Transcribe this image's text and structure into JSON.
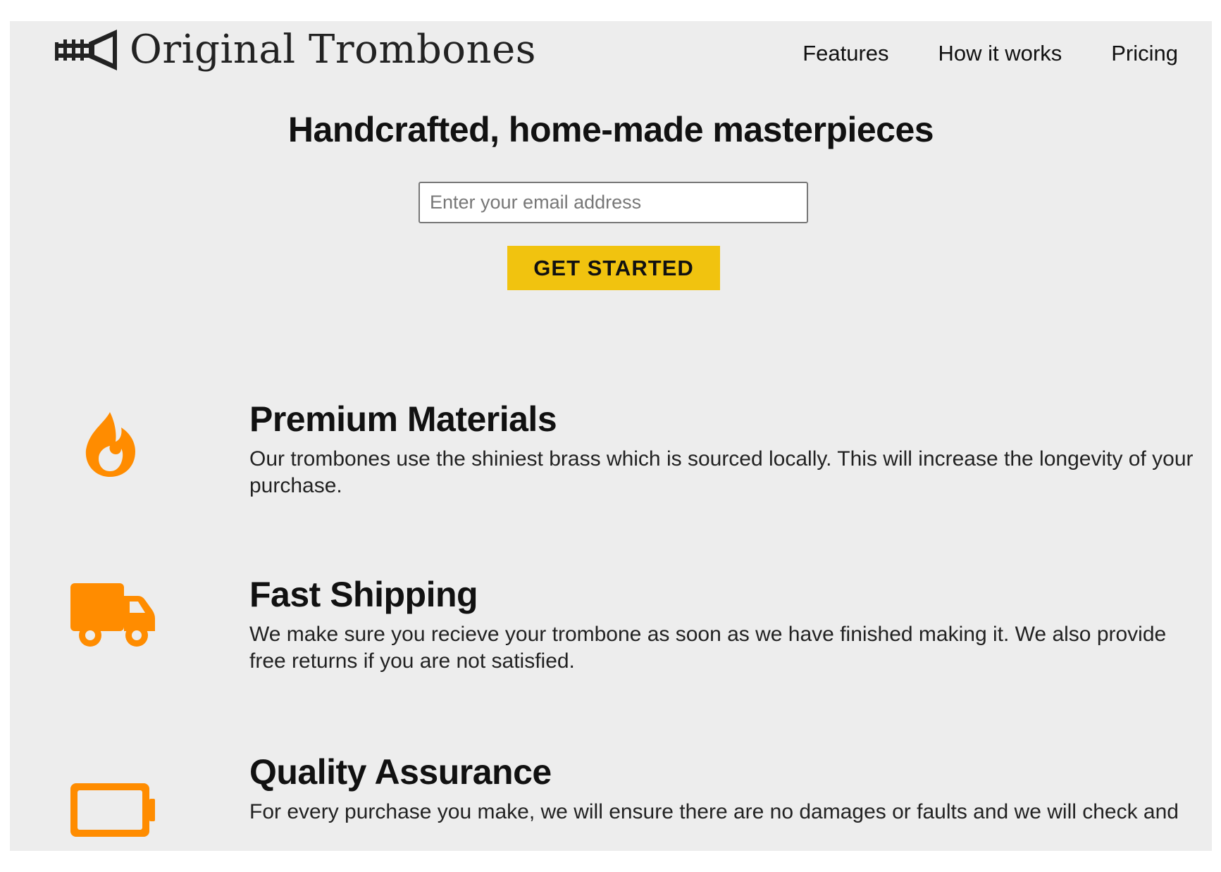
{
  "brand": {
    "name": "Original Trombones",
    "logo_icon": "trombone-icon"
  },
  "nav": {
    "items": [
      {
        "label": "Features"
      },
      {
        "label": "How it works"
      },
      {
        "label": "Pricing"
      }
    ]
  },
  "hero": {
    "headline": "Handcrafted, home-made masterpieces",
    "email_placeholder": "Enter your email address",
    "email_value": "",
    "cta_label": "GET STARTED",
    "cta_color": "#f1c30f"
  },
  "features": [
    {
      "icon": "fire-icon",
      "title": "Premium Materials",
      "description": "Our trombones use the shiniest brass which is sourced locally. This will increase the longevity of your purchase."
    },
    {
      "icon": "truck-icon",
      "title": "Fast Shipping",
      "description": "We make sure you recieve your trombone as soon as we have finished making it. We also provide free returns if you are not satisfied."
    },
    {
      "icon": "battery-icon",
      "title": "Quality Assurance",
      "description": "For every purchase you make, we will ensure there are no damages or faults and we will check and"
    }
  ],
  "colors": {
    "accent_orange": "#ff8c00",
    "page_background": "#ededed"
  }
}
